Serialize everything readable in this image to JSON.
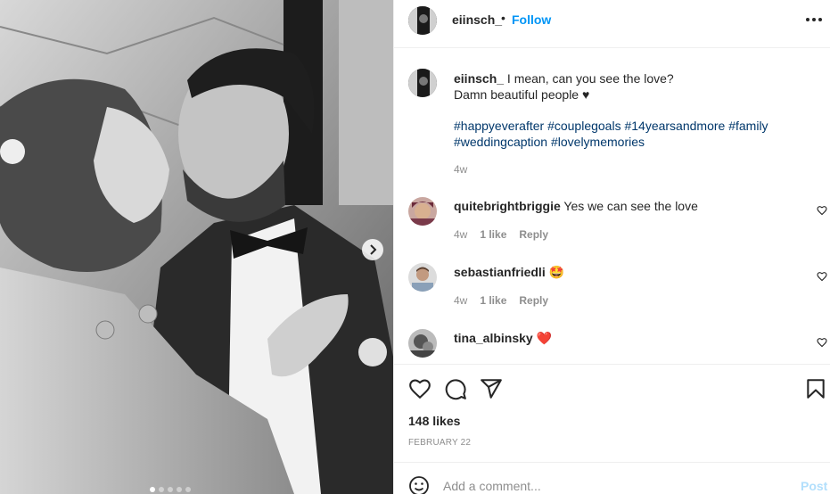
{
  "post": {
    "username": "eiinsch_",
    "separator": "•",
    "follow_label": "Follow",
    "more_icon": "more-horizontal-icon",
    "caption_text": "I mean, can you see the love?",
    "caption_line2": "Damn beautiful people ♥",
    "hashtags_line1": "#happyeverafter #couplegoals #14yearsandmore #family",
    "hashtags_line2": "#weddingcaption #lovelymemories",
    "caption_time": "4w"
  },
  "comments": [
    {
      "username": "quitebrightbriggie",
      "text": "Yes we can see the love",
      "time": "4w",
      "likes": "1 like",
      "reply": "Reply"
    },
    {
      "username": "sebastianfriedli",
      "text": "🤩",
      "time": "4w",
      "likes": "1 like",
      "reply": "Reply"
    },
    {
      "username": "tina_albinsky",
      "text": "❤️",
      "time": "",
      "likes": "",
      "reply": ""
    }
  ],
  "actions": {
    "like_icon": "heart-icon",
    "comment_icon": "comment-icon",
    "share_icon": "share-icon",
    "save_icon": "bookmark-icon",
    "likes_count": "148 likes",
    "date": "FEBRUARY 22"
  },
  "add_comment": {
    "placeholder": "Add a comment...",
    "post_label": "Post",
    "emoji_icon": "emoji-icon"
  },
  "colors": {
    "accent": "#0095f6",
    "hashtag": "#00376b",
    "muted": "#8e8e8e"
  }
}
